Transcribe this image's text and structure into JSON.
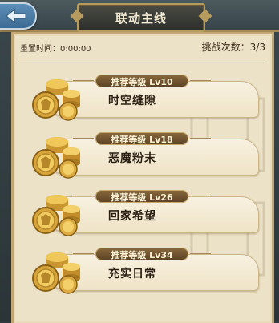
{
  "header": {
    "title": "联动主线",
    "back_icon": "back-arrow-icon"
  },
  "info": {
    "reset_label": "重置时间：0:00:00",
    "attempts_label": "挑战次数：3/3"
  },
  "stages": [
    {
      "level": "推荐等级  Lv10",
      "name": "时空缝隙",
      "icon": "gold-coins-icon"
    },
    {
      "level": "推荐等级  Lv18",
      "name": "恶魔粉末",
      "icon": "gold-coins-icon"
    },
    {
      "level": "推荐等级  Lv26",
      "name": "回家希望",
      "icon": "gold-coins-icon"
    },
    {
      "level": "推荐等级  Lv34",
      "name": "充实日常",
      "icon": "gold-coins-icon"
    }
  ],
  "colors": {
    "panel": "#ece2c8",
    "gold_trim": "#c2a774",
    "badge": "#6e5230",
    "back_button": "#4a7ca4"
  }
}
